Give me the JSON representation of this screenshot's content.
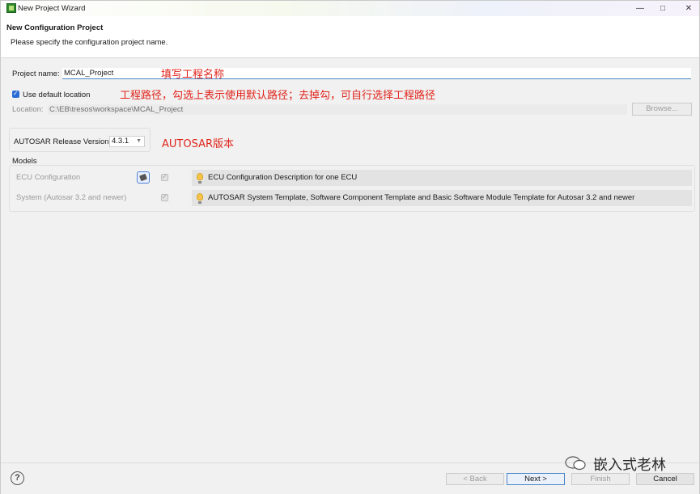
{
  "window": {
    "title": "New Project Wizard"
  },
  "header": {
    "title": "New Configuration Project",
    "description": "Please specify the configuration project name."
  },
  "form": {
    "project_name_label": "Project name:",
    "project_name_value": "MCAL_Project",
    "use_default_label": "Use default location",
    "location_label": "Location:",
    "location_value": "C:\\EB\\tresos\\workspace\\MCAL_Project",
    "browse_label": "Browse...",
    "autosar_label": "AUTOSAR Release Version:",
    "autosar_value": "4.3.1",
    "models_label": "Models"
  },
  "models": [
    {
      "name": "ECU Configuration",
      "description": "ECU Configuration Description for one ECU"
    },
    {
      "name": "System (Autosar 3.2 and newer)",
      "description": "AUTOSAR System Template, Software Component Template and Basic Software Module Template for Autosar 3.2 and newer"
    }
  ],
  "annotations": {
    "project_name": "填写工程名称",
    "location": "工程路径，勾选上表示使用默认路径；去掉勾，可自行选择工程路径",
    "autosar": "AUTOSAR版本"
  },
  "footer": {
    "back": "< Back",
    "next": "Next >",
    "finish": "Finish",
    "cancel": "Cancel",
    "help": "?"
  },
  "watermark": "嵌入式老林",
  "colors": {
    "annotation": "#e0241b",
    "accent": "#4a86c8"
  }
}
